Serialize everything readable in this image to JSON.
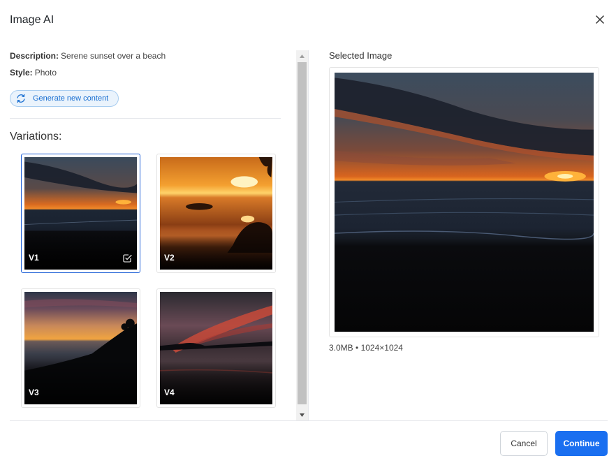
{
  "dialog": {
    "title": "Image AI"
  },
  "info": {
    "description_label": "Description:",
    "description_value": "Serene sunset over a beach",
    "style_label": "Style:",
    "style_value": "Photo"
  },
  "generate_button": {
    "label": "Generate new content",
    "icon": "refresh-icon"
  },
  "variations": {
    "title": "Variations:",
    "items": [
      {
        "label": "V1",
        "selected": true
      },
      {
        "label": "V2",
        "selected": false
      },
      {
        "label": "V3",
        "selected": false
      },
      {
        "label": "V4",
        "selected": false
      }
    ]
  },
  "selected_image": {
    "title": "Selected Image",
    "size": "3.0MB",
    "separator": "•",
    "dimensions": "1024×1024"
  },
  "footer": {
    "cancel_label": "Cancel",
    "continue_label": "Continue"
  },
  "colors": {
    "accent": "#1a6ff0",
    "selected_border": "#1d5fd6",
    "generate_bg": "#eaf3fc",
    "generate_text": "#1a6fd1"
  }
}
